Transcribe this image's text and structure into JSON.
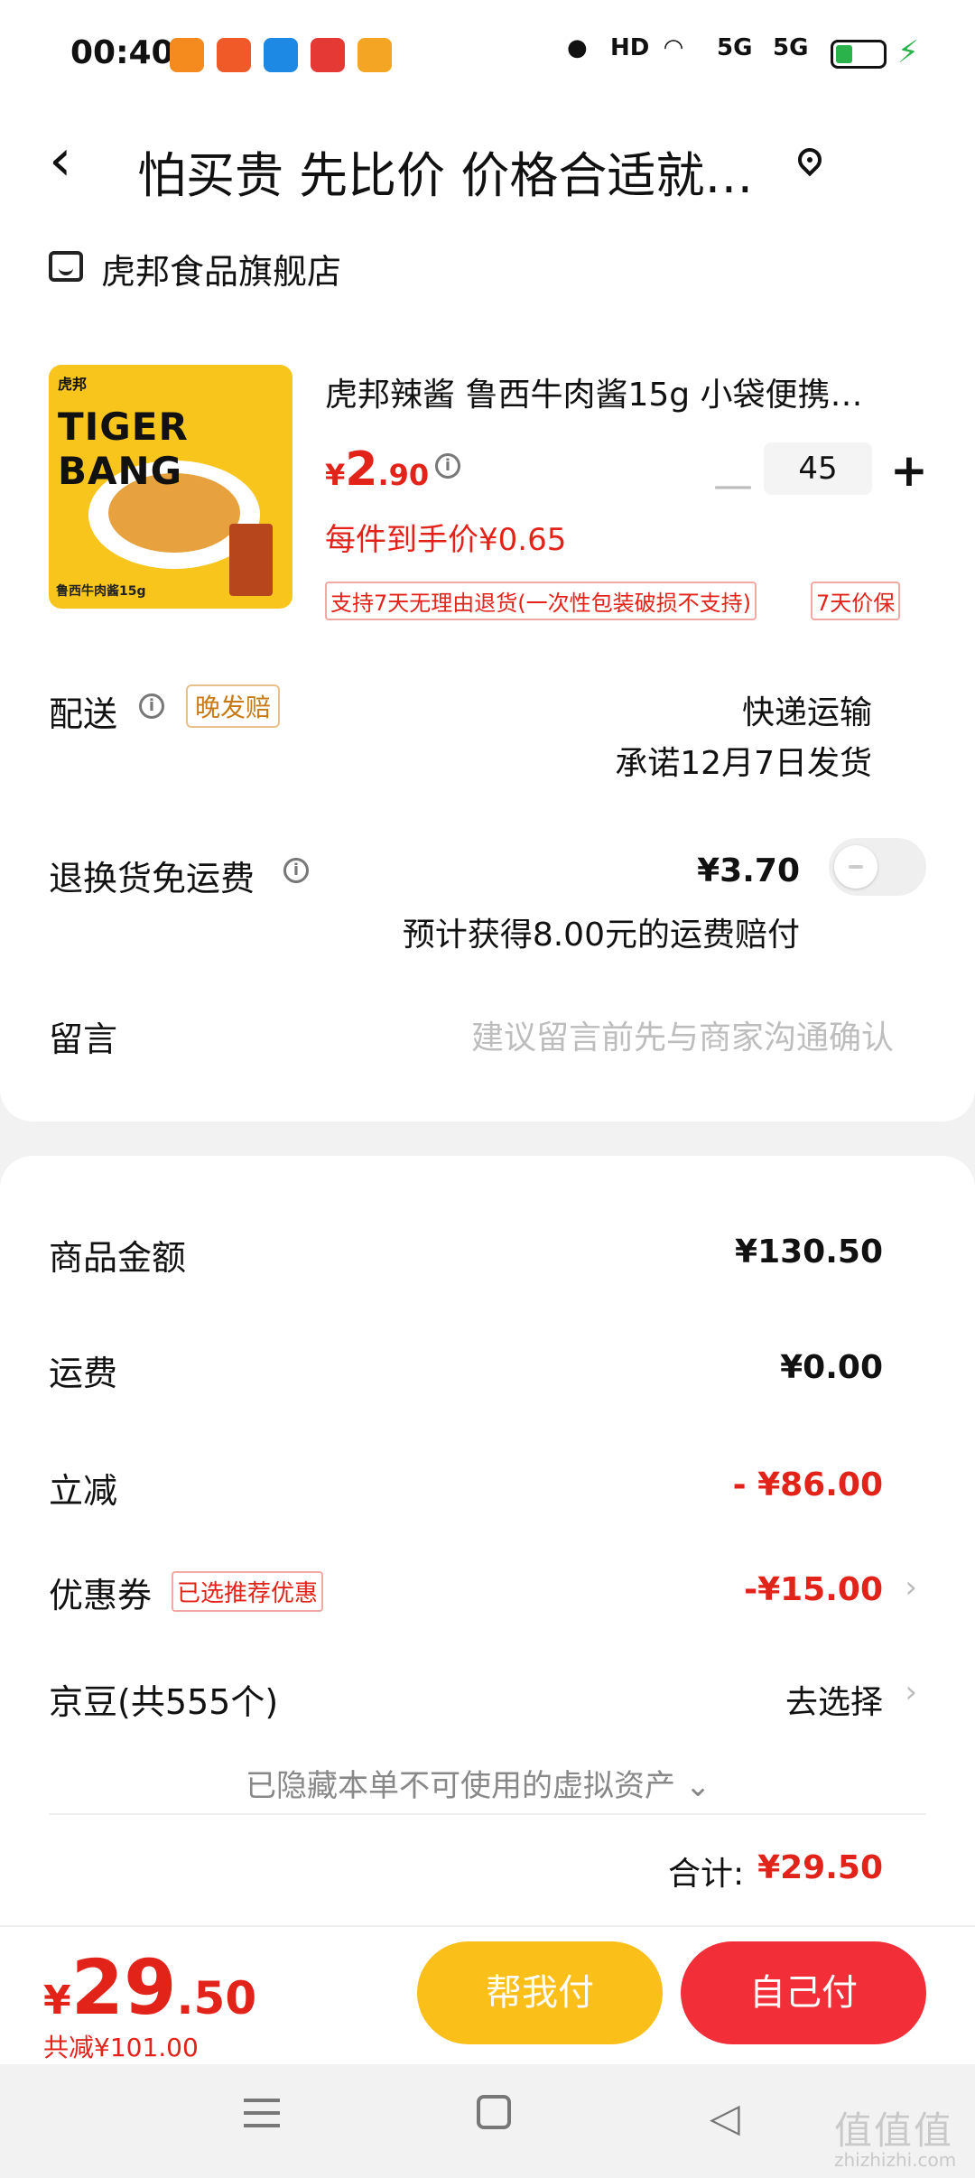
{
  "status_bar": {
    "time": "00:40",
    "indicators": [
      "location-icon",
      "HD",
      "wifi-icon",
      "5G",
      "5G"
    ],
    "battery_level": 0.3,
    "app_icon_colors": [
      "#f58a1f",
      "#f05a28",
      "#1e88e5",
      "#e53935",
      "#f5a524"
    ]
  },
  "header": {
    "title": "怕买贵 先比价 价格合适就…",
    "back_icon": "back-icon",
    "location_icon": "location-pin-icon"
  },
  "store": {
    "name": "虎邦食品旗舰店"
  },
  "product": {
    "image_brand": "TIGER BANG",
    "image_logo": "虎邦",
    "image_caption": "鲁西牛肉酱15g",
    "name": "虎邦辣酱  鲁西牛肉酱15g  小袋便携…",
    "price_symbol": "¥",
    "price_int": "2",
    "price_dec": ".90",
    "quantity": "45",
    "unit_price_label": "每件到手价¥0.65",
    "tags": [
      "支持7天无理由退货(一次性包装破损不支持)",
      "7天价保"
    ]
  },
  "delivery": {
    "label": "配送",
    "late_tag": "晚发赔",
    "method": "快递运输",
    "promise": "承诺12月7日发货"
  },
  "return_shipping": {
    "label": "退换货免运费",
    "price": "¥3.70",
    "note": "预计获得8.00元的运费赔付",
    "enabled": false
  },
  "message": {
    "label": "留言",
    "placeholder": "建议留言前先与商家沟通确认"
  },
  "summary": {
    "goods_label": "商品金额",
    "goods_value": "¥130.50",
    "shipping_label": "运费",
    "shipping_value": "¥0.00",
    "discount_label": "立减",
    "discount_value": "- ¥86.00",
    "coupon_label": "优惠券",
    "coupon_tag": "已选推荐优惠",
    "coupon_value": "-¥15.00",
    "beans_label": "京豆(共555个)",
    "beans_value": "去选择",
    "hidden_assets": "已隐藏本单不可使用的虚拟资产",
    "total_label": "合计:",
    "total_value": "¥29.50"
  },
  "bottom": {
    "total_symbol": "¥",
    "total_int": "29",
    "total_dec": ".50",
    "saved": "共减¥101.00",
    "help_pay": "帮我付",
    "self_pay": "自己付"
  },
  "watermark": {
    "text": "值值值",
    "sub": "zhizhizhi.com"
  },
  "colors": {
    "accent_red": "#e2231a",
    "button_yellow": "#fbbf1a",
    "button_red": "#f22f38"
  }
}
